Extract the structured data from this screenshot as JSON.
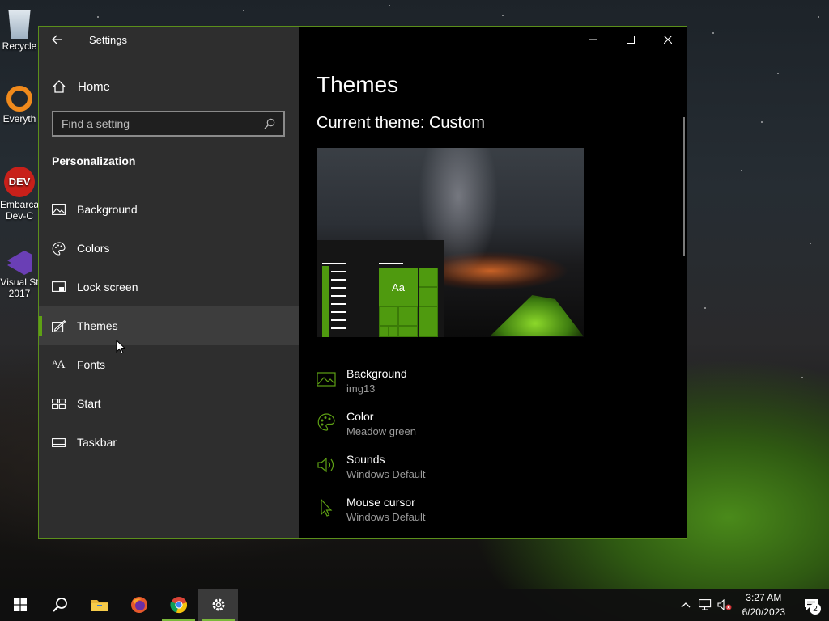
{
  "desktop": {
    "icons": [
      {
        "label": "Recycle",
        "name": "recycle-bin"
      },
      {
        "label": "Everyth",
        "name": "everything"
      },
      {
        "label": "Embarca",
        "label2": "Dev-C",
        "name": "embarcadero-dev-cpp"
      },
      {
        "label": "Visual St",
        "label2": "2017",
        "name": "visual-studio"
      }
    ]
  },
  "window": {
    "title": "Settings",
    "controls": {
      "minimize": "minimize-icon",
      "maximize": "maximize-icon",
      "close": "close-icon"
    }
  },
  "sidebar": {
    "home_label": "Home",
    "search_placeholder": "Find a setting",
    "section_title": "Personalization",
    "items": [
      {
        "label": "Background",
        "icon": "picture-icon"
      },
      {
        "label": "Colors",
        "icon": "palette-icon"
      },
      {
        "label": "Lock screen",
        "icon": "lock-screen-icon"
      },
      {
        "label": "Themes",
        "icon": "themes-icon",
        "active": true
      },
      {
        "label": "Fonts",
        "icon": "fonts-icon"
      },
      {
        "label": "Start",
        "icon": "start-icon"
      },
      {
        "label": "Taskbar",
        "icon": "taskbar-icon"
      }
    ]
  },
  "main": {
    "heading": "Themes",
    "current_theme": "Current theme: Custom",
    "preview_tile_text": "Aa",
    "settings": [
      {
        "name": "Background",
        "value": "img13",
        "icon": "picture-icon"
      },
      {
        "name": "Color",
        "value": "Meadow green",
        "icon": "palette-icon"
      },
      {
        "name": "Sounds",
        "value": "Windows Default",
        "icon": "speaker-icon"
      },
      {
        "name": "Mouse cursor",
        "value": "Windows Default",
        "icon": "cursor-icon"
      }
    ]
  },
  "taskbar": {
    "apps": [
      "start-icon",
      "search-icon",
      "file-explorer-icon",
      "firefox-icon",
      "chrome-icon",
      "settings-icon"
    ],
    "time": "3:27 AM",
    "date": "6/20/2023",
    "notification_count": "2"
  },
  "colors": {
    "accent": "#5ea114",
    "sidebar_bg": "#303030",
    "main_bg": "#000000"
  }
}
